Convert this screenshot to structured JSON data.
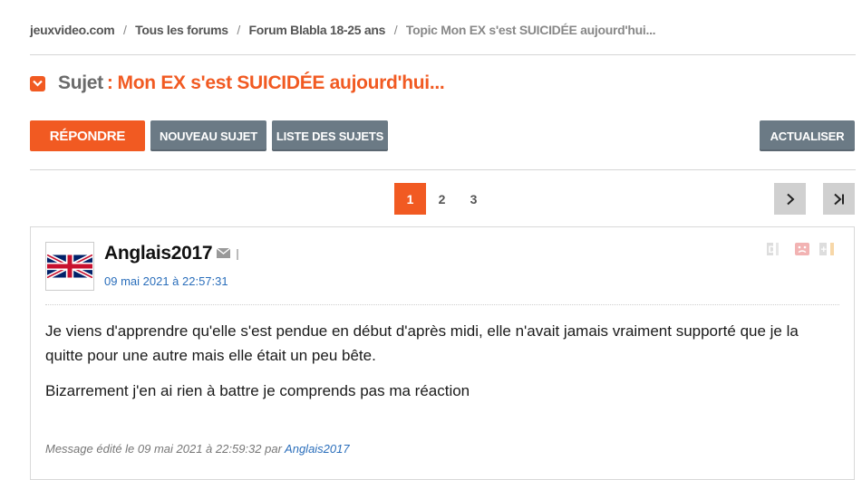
{
  "breadcrumb": {
    "items": [
      "jeuxvideo.com",
      "Tous les forums",
      "Forum Blabla 18-25 ans"
    ],
    "current": "Topic Mon EX s'est SUICIDÉE aujourd'hui..."
  },
  "subject": {
    "label": "Sujet",
    "colon": ":",
    "title": "Mon EX s'est SUICIDÉE aujourd'hui..."
  },
  "toolbar": {
    "reply": "Répondre",
    "new_topic": "Nouveau sujet",
    "topic_list": "Liste des sujets",
    "refresh": "Actualiser"
  },
  "pagination": {
    "pages": [
      "1",
      "2",
      "3"
    ],
    "current": "1"
  },
  "post": {
    "author": "Anglais2017",
    "date": "09 mai 2021 à 22:57:31",
    "paragraphs": [
      "Je viens d'apprendre qu'elle s'est pendue en début d'après midi, elle n'avait jamais vraiment supporté que je la quitte pour une autre mais elle était un peu bête.",
      "Bizarrement j'en ai rien à battre je comprends pas ma réaction"
    ],
    "edited_prefix": "Message édité le 09 mai 2021 à 22:59:32 par",
    "edited_by": "Anglais2017"
  },
  "colors": {
    "accent": "#f15a22",
    "button_grey": "#6b7a85",
    "link_blue": "#2a6ebb"
  },
  "icons": {
    "subject": "chevron-down-icon",
    "mail": "mail-icon",
    "next": "chevron-right-icon",
    "last": "last-page-icon",
    "avatar": "uk-flag-icon"
  }
}
